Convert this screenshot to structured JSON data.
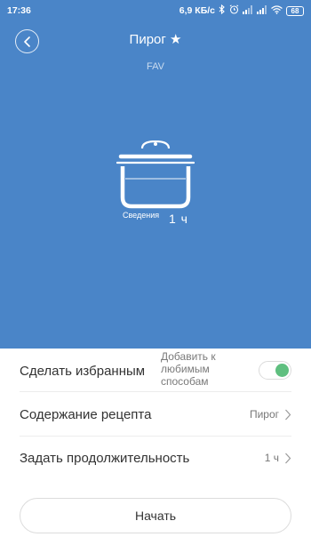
{
  "status_bar": {
    "time": "17:36",
    "speed": "6,9 КБ/с",
    "battery": "68",
    "icons": [
      "bluetooth-icon",
      "alarm-icon",
      "signal-icon",
      "signal-icon",
      "wifi-icon",
      "battery-icon"
    ]
  },
  "header": {
    "title": "Пирог ★",
    "subtitle": "FAV"
  },
  "mode": {
    "label": "Сведения",
    "time": "1 ч",
    "icon": "pot-icon"
  },
  "settings": {
    "favorite": {
      "label": "Сделать избранным",
      "hint": "Добавить к любимым способам",
      "toggle_on": true
    },
    "recipe": {
      "label": "Содержание рецепта",
      "value": "Пирог"
    },
    "duration": {
      "label": "Задать продолжительность",
      "value": "1 ч"
    }
  },
  "start_button": "Начать",
  "colors": {
    "hero_bg": "#4a85c8",
    "toggle_on": "#5fbf7f"
  }
}
